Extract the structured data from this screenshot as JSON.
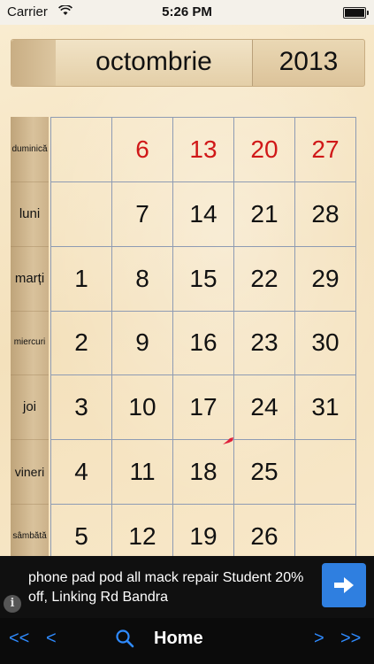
{
  "status_bar": {
    "carrier": "Carrier",
    "time": "5:26 PM",
    "battery_level": 1.0,
    "icons": [
      "wifi-icon",
      "battery-icon"
    ]
  },
  "calendar": {
    "month": "octombrie",
    "year": "2013",
    "weekdays": [
      "duminică",
      "luni",
      "marți",
      "miercuri",
      "joi",
      "vineri",
      "sâmbătă"
    ],
    "weeks": [
      [
        "",
        "",
        "1",
        "2",
        "3",
        "4",
        "5"
      ],
      [
        "6",
        "7",
        "8",
        "9",
        "10",
        "11",
        "12"
      ],
      [
        "13",
        "14",
        "15",
        "16",
        "17",
        "18",
        "19"
      ],
      [
        "20",
        "21",
        "22",
        "23",
        "24",
        "25",
        "26"
      ],
      [
        "27",
        "28",
        "29",
        "30",
        "31",
        "",
        ""
      ]
    ],
    "sunday_color": "#d01818",
    "text_color": "#111111",
    "grid_color": "#8e9bb3",
    "marker_color": "#e0203a",
    "marked_day": "18"
  },
  "ad": {
    "text": "phone pad pod all mack repair Student 20% off, Linking Rd Bandra",
    "info_label": "i",
    "button_color": "#2f7fe0"
  },
  "toolbar": {
    "first_label": "<<",
    "prev_label": "<",
    "home_label": "Home",
    "next_label": ">",
    "last_label": ">>",
    "accent_color": "#2f8bff",
    "icons": [
      "search-icon"
    ]
  }
}
